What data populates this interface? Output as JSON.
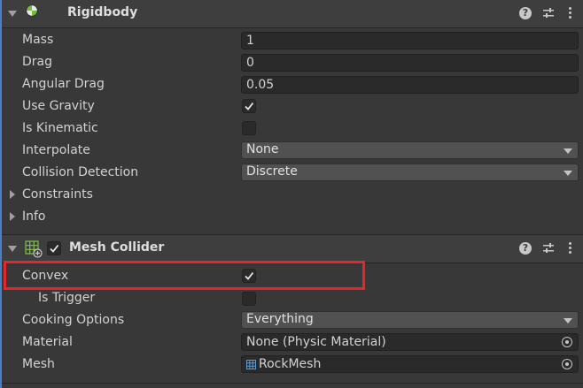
{
  "rigidbody": {
    "title": "Rigidbody",
    "fields": {
      "mass": {
        "label": "Mass",
        "value": "1"
      },
      "drag": {
        "label": "Drag",
        "value": "0"
      },
      "angular_drag": {
        "label": "Angular Drag",
        "value": "0.05"
      },
      "use_gravity": {
        "label": "Use Gravity",
        "checked": true
      },
      "is_kinematic": {
        "label": "Is Kinematic",
        "checked": false
      },
      "interpolate": {
        "label": "Interpolate",
        "value": "None"
      },
      "collision_detection": {
        "label": "Collision Detection",
        "value": "Discrete"
      }
    },
    "constraints_label": "Constraints",
    "info_label": "Info"
  },
  "mesh_collider": {
    "title": "Mesh Collider",
    "enabled": true,
    "fields": {
      "convex": {
        "label": "Convex",
        "checked": true
      },
      "is_trigger": {
        "label": "Is Trigger",
        "checked": false
      },
      "cooking_options": {
        "label": "Cooking Options",
        "value": "Everything"
      },
      "material": {
        "label": "Material",
        "value": "None (Physic Material)"
      },
      "mesh": {
        "label": "Mesh",
        "value": "RockMesh"
      }
    }
  },
  "help_glyph": "?",
  "colors": {
    "highlight": "#e5262d",
    "accent": "#4d7fc4",
    "background": "#383838"
  }
}
